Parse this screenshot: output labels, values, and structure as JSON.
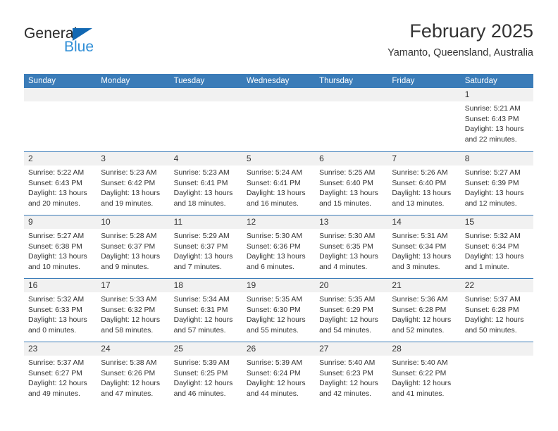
{
  "brand": {
    "name_top": "General",
    "name_bottom": "Blue",
    "color_dark": "#2b2b2b",
    "color_blue": "#2f8ed6",
    "triangle_color": "#1268b3"
  },
  "header": {
    "title": "February 2025",
    "subtitle": "Yamanto, Queensland, Australia"
  },
  "theme": {
    "header_blue": "#3b7cb8",
    "day_band_gray": "#f1f1f1",
    "text": "#333333"
  },
  "weekdays": [
    "Sunday",
    "Monday",
    "Tuesday",
    "Wednesday",
    "Thursday",
    "Friday",
    "Saturday"
  ],
  "labels": {
    "sunrise_prefix": "Sunrise:",
    "sunset_prefix": "Sunset:",
    "daylight_prefix": "Daylight:"
  },
  "weeks": [
    [
      {
        "day": "",
        "empty": true
      },
      {
        "day": "",
        "empty": true
      },
      {
        "day": "",
        "empty": true
      },
      {
        "day": "",
        "empty": true
      },
      {
        "day": "",
        "empty": true
      },
      {
        "day": "",
        "empty": true
      },
      {
        "day": "1",
        "sunrise": "Sunrise: 5:21 AM",
        "sunset": "Sunset: 6:43 PM",
        "daylight_1": "Daylight: 13 hours",
        "daylight_2": "and 22 minutes."
      }
    ],
    [
      {
        "day": "2",
        "sunrise": "Sunrise: 5:22 AM",
        "sunset": "Sunset: 6:43 PM",
        "daylight_1": "Daylight: 13 hours",
        "daylight_2": "and 20 minutes."
      },
      {
        "day": "3",
        "sunrise": "Sunrise: 5:23 AM",
        "sunset": "Sunset: 6:42 PM",
        "daylight_1": "Daylight: 13 hours",
        "daylight_2": "and 19 minutes."
      },
      {
        "day": "4",
        "sunrise": "Sunrise: 5:23 AM",
        "sunset": "Sunset: 6:41 PM",
        "daylight_1": "Daylight: 13 hours",
        "daylight_2": "and 18 minutes."
      },
      {
        "day": "5",
        "sunrise": "Sunrise: 5:24 AM",
        "sunset": "Sunset: 6:41 PM",
        "daylight_1": "Daylight: 13 hours",
        "daylight_2": "and 16 minutes."
      },
      {
        "day": "6",
        "sunrise": "Sunrise: 5:25 AM",
        "sunset": "Sunset: 6:40 PM",
        "daylight_1": "Daylight: 13 hours",
        "daylight_2": "and 15 minutes."
      },
      {
        "day": "7",
        "sunrise": "Sunrise: 5:26 AM",
        "sunset": "Sunset: 6:40 PM",
        "daylight_1": "Daylight: 13 hours",
        "daylight_2": "and 13 minutes."
      },
      {
        "day": "8",
        "sunrise": "Sunrise: 5:27 AM",
        "sunset": "Sunset: 6:39 PM",
        "daylight_1": "Daylight: 13 hours",
        "daylight_2": "and 12 minutes."
      }
    ],
    [
      {
        "day": "9",
        "sunrise": "Sunrise: 5:27 AM",
        "sunset": "Sunset: 6:38 PM",
        "daylight_1": "Daylight: 13 hours",
        "daylight_2": "and 10 minutes."
      },
      {
        "day": "10",
        "sunrise": "Sunrise: 5:28 AM",
        "sunset": "Sunset: 6:37 PM",
        "daylight_1": "Daylight: 13 hours",
        "daylight_2": "and 9 minutes."
      },
      {
        "day": "11",
        "sunrise": "Sunrise: 5:29 AM",
        "sunset": "Sunset: 6:37 PM",
        "daylight_1": "Daylight: 13 hours",
        "daylight_2": "and 7 minutes."
      },
      {
        "day": "12",
        "sunrise": "Sunrise: 5:30 AM",
        "sunset": "Sunset: 6:36 PM",
        "daylight_1": "Daylight: 13 hours",
        "daylight_2": "and 6 minutes."
      },
      {
        "day": "13",
        "sunrise": "Sunrise: 5:30 AM",
        "sunset": "Sunset: 6:35 PM",
        "daylight_1": "Daylight: 13 hours",
        "daylight_2": "and 4 minutes."
      },
      {
        "day": "14",
        "sunrise": "Sunrise: 5:31 AM",
        "sunset": "Sunset: 6:34 PM",
        "daylight_1": "Daylight: 13 hours",
        "daylight_2": "and 3 minutes."
      },
      {
        "day": "15",
        "sunrise": "Sunrise: 5:32 AM",
        "sunset": "Sunset: 6:34 PM",
        "daylight_1": "Daylight: 13 hours",
        "daylight_2": "and 1 minute."
      }
    ],
    [
      {
        "day": "16",
        "sunrise": "Sunrise: 5:32 AM",
        "sunset": "Sunset: 6:33 PM",
        "daylight_1": "Daylight: 13 hours",
        "daylight_2": "and 0 minutes."
      },
      {
        "day": "17",
        "sunrise": "Sunrise: 5:33 AM",
        "sunset": "Sunset: 6:32 PM",
        "daylight_1": "Daylight: 12 hours",
        "daylight_2": "and 58 minutes."
      },
      {
        "day": "18",
        "sunrise": "Sunrise: 5:34 AM",
        "sunset": "Sunset: 6:31 PM",
        "daylight_1": "Daylight: 12 hours",
        "daylight_2": "and 57 minutes."
      },
      {
        "day": "19",
        "sunrise": "Sunrise: 5:35 AM",
        "sunset": "Sunset: 6:30 PM",
        "daylight_1": "Daylight: 12 hours",
        "daylight_2": "and 55 minutes."
      },
      {
        "day": "20",
        "sunrise": "Sunrise: 5:35 AM",
        "sunset": "Sunset: 6:29 PM",
        "daylight_1": "Daylight: 12 hours",
        "daylight_2": "and 54 minutes."
      },
      {
        "day": "21",
        "sunrise": "Sunrise: 5:36 AM",
        "sunset": "Sunset: 6:28 PM",
        "daylight_1": "Daylight: 12 hours",
        "daylight_2": "and 52 minutes."
      },
      {
        "day": "22",
        "sunrise": "Sunrise: 5:37 AM",
        "sunset": "Sunset: 6:28 PM",
        "daylight_1": "Daylight: 12 hours",
        "daylight_2": "and 50 minutes."
      }
    ],
    [
      {
        "day": "23",
        "sunrise": "Sunrise: 5:37 AM",
        "sunset": "Sunset: 6:27 PM",
        "daylight_1": "Daylight: 12 hours",
        "daylight_2": "and 49 minutes."
      },
      {
        "day": "24",
        "sunrise": "Sunrise: 5:38 AM",
        "sunset": "Sunset: 6:26 PM",
        "daylight_1": "Daylight: 12 hours",
        "daylight_2": "and 47 minutes."
      },
      {
        "day": "25",
        "sunrise": "Sunrise: 5:39 AM",
        "sunset": "Sunset: 6:25 PM",
        "daylight_1": "Daylight: 12 hours",
        "daylight_2": "and 46 minutes."
      },
      {
        "day": "26",
        "sunrise": "Sunrise: 5:39 AM",
        "sunset": "Sunset: 6:24 PM",
        "daylight_1": "Daylight: 12 hours",
        "daylight_2": "and 44 minutes."
      },
      {
        "day": "27",
        "sunrise": "Sunrise: 5:40 AM",
        "sunset": "Sunset: 6:23 PM",
        "daylight_1": "Daylight: 12 hours",
        "daylight_2": "and 42 minutes."
      },
      {
        "day": "28",
        "sunrise": "Sunrise: 5:40 AM",
        "sunset": "Sunset: 6:22 PM",
        "daylight_1": "Daylight: 12 hours",
        "daylight_2": "and 41 minutes."
      },
      {
        "day": "",
        "empty": true
      }
    ]
  ]
}
